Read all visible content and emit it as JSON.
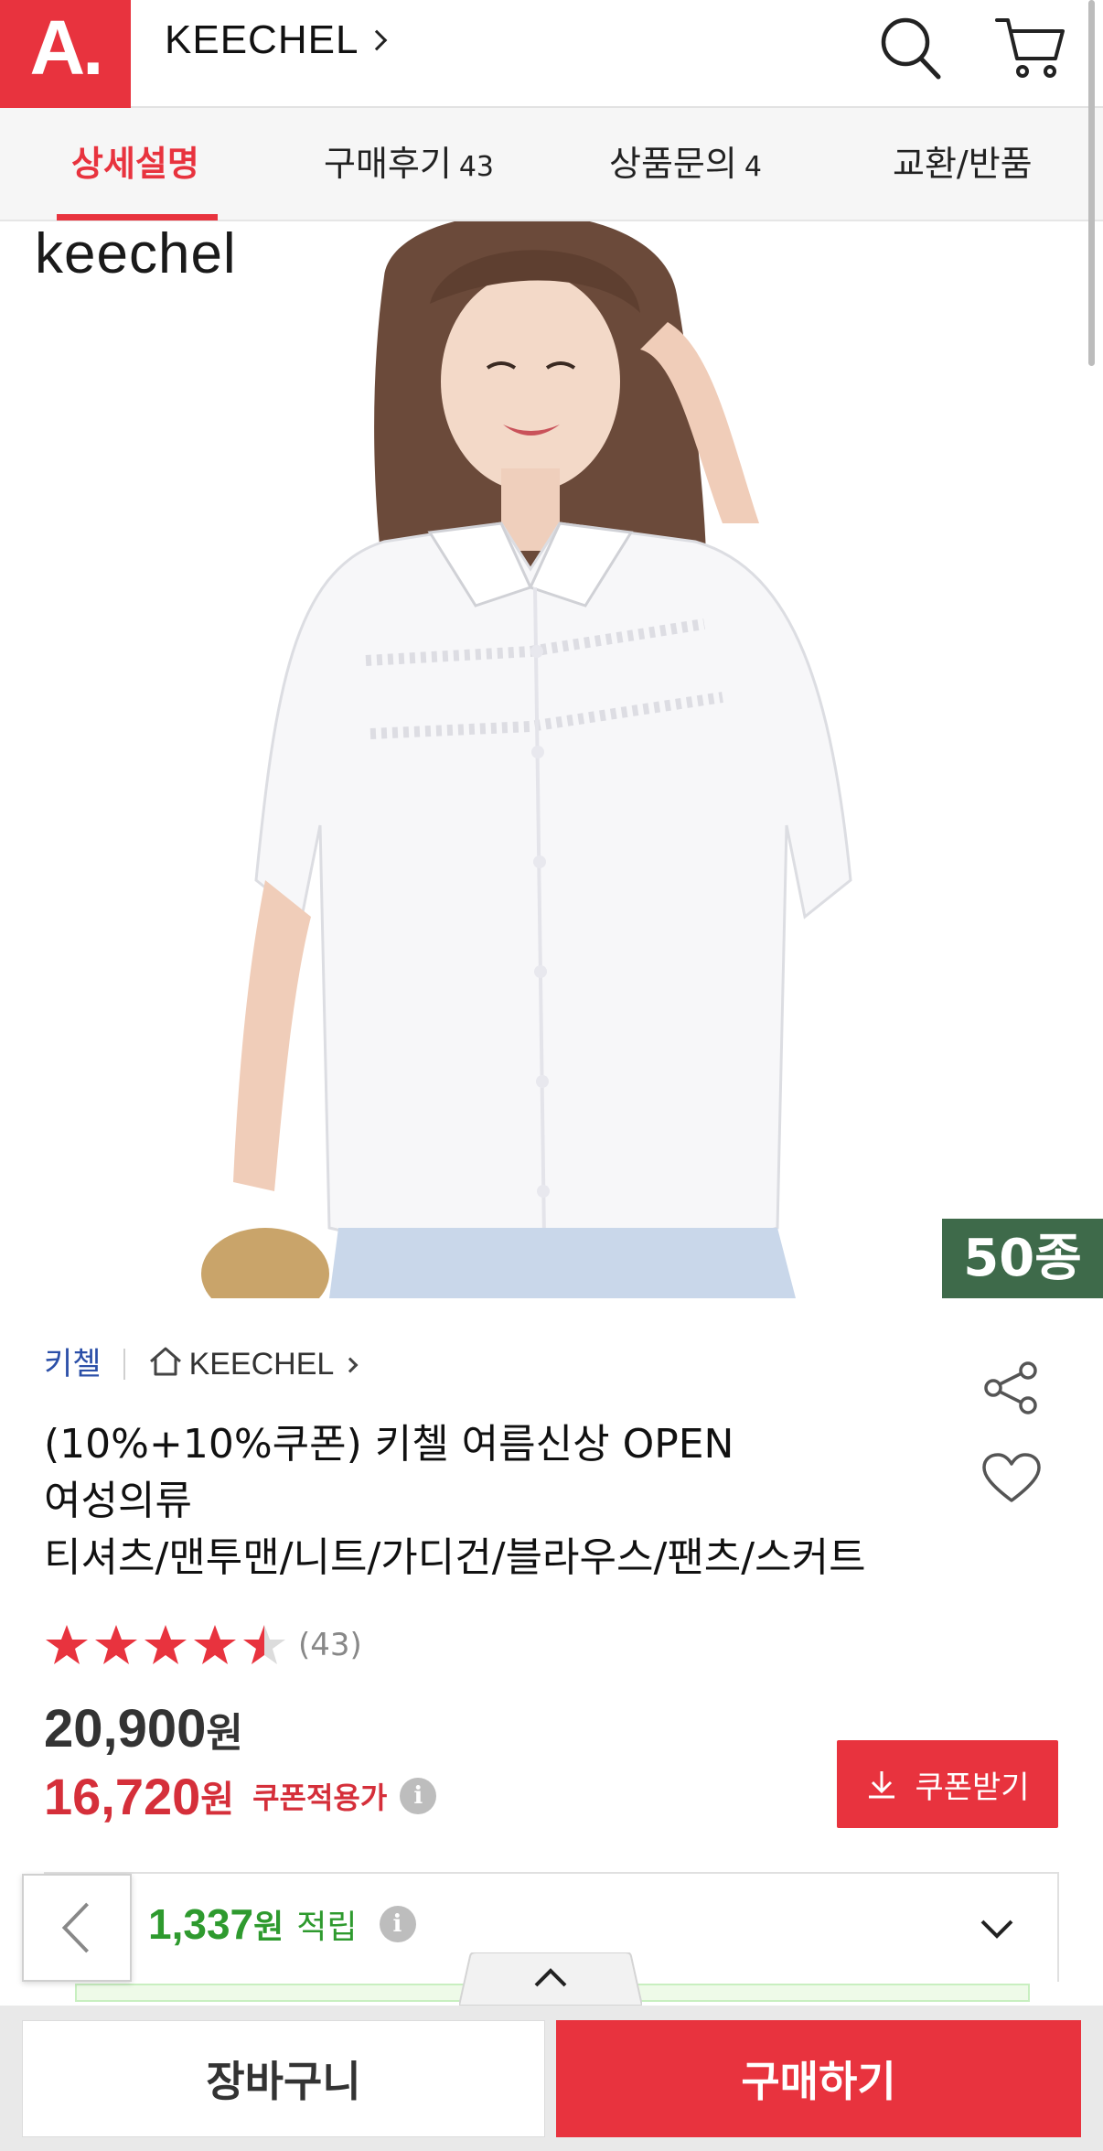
{
  "header": {
    "logo": "A.",
    "store_name": "KEECHEL",
    "icons": [
      "search-icon",
      "cart-icon"
    ]
  },
  "tabs": [
    {
      "label": "상세설명",
      "count": "",
      "active": true
    },
    {
      "label": "구매후기",
      "count": "43",
      "active": false
    },
    {
      "label": "상품문의",
      "count": "4",
      "active": false
    },
    {
      "label": "교환/반품",
      "count": "",
      "active": false
    }
  ],
  "product": {
    "image_brand": "keechel",
    "variant_badge": "50종",
    "seller": "키첼",
    "brand": "KEECHEL",
    "title_lines": [
      "(10%+10%쿠폰) 키첼 여름신상 OPEN",
      "여성의류",
      "티셔츠/맨투맨/니트/가디건/블라우스/팬츠/스커트"
    ],
    "rating": 4.5,
    "review_count": "(43)",
    "price": "20,900",
    "price_unit": "원",
    "sale_price": "16,720",
    "sale_unit": "원",
    "sale_label": "쿠폰적용가",
    "info_glyph": "i"
  },
  "coupon_button": "쿠폰받기",
  "points": {
    "amount": "1,337",
    "unit": "원",
    "label": "적립"
  },
  "bottom": {
    "cart_label": "장바구니",
    "buy_label": "구매하기"
  },
  "colors": {
    "brand_red": "#e8333e",
    "sale_red": "#d52f3a",
    "points_green": "#2e9a2e",
    "badge_green": "#3e6a4a",
    "seller_blue": "#2b4fa8"
  }
}
